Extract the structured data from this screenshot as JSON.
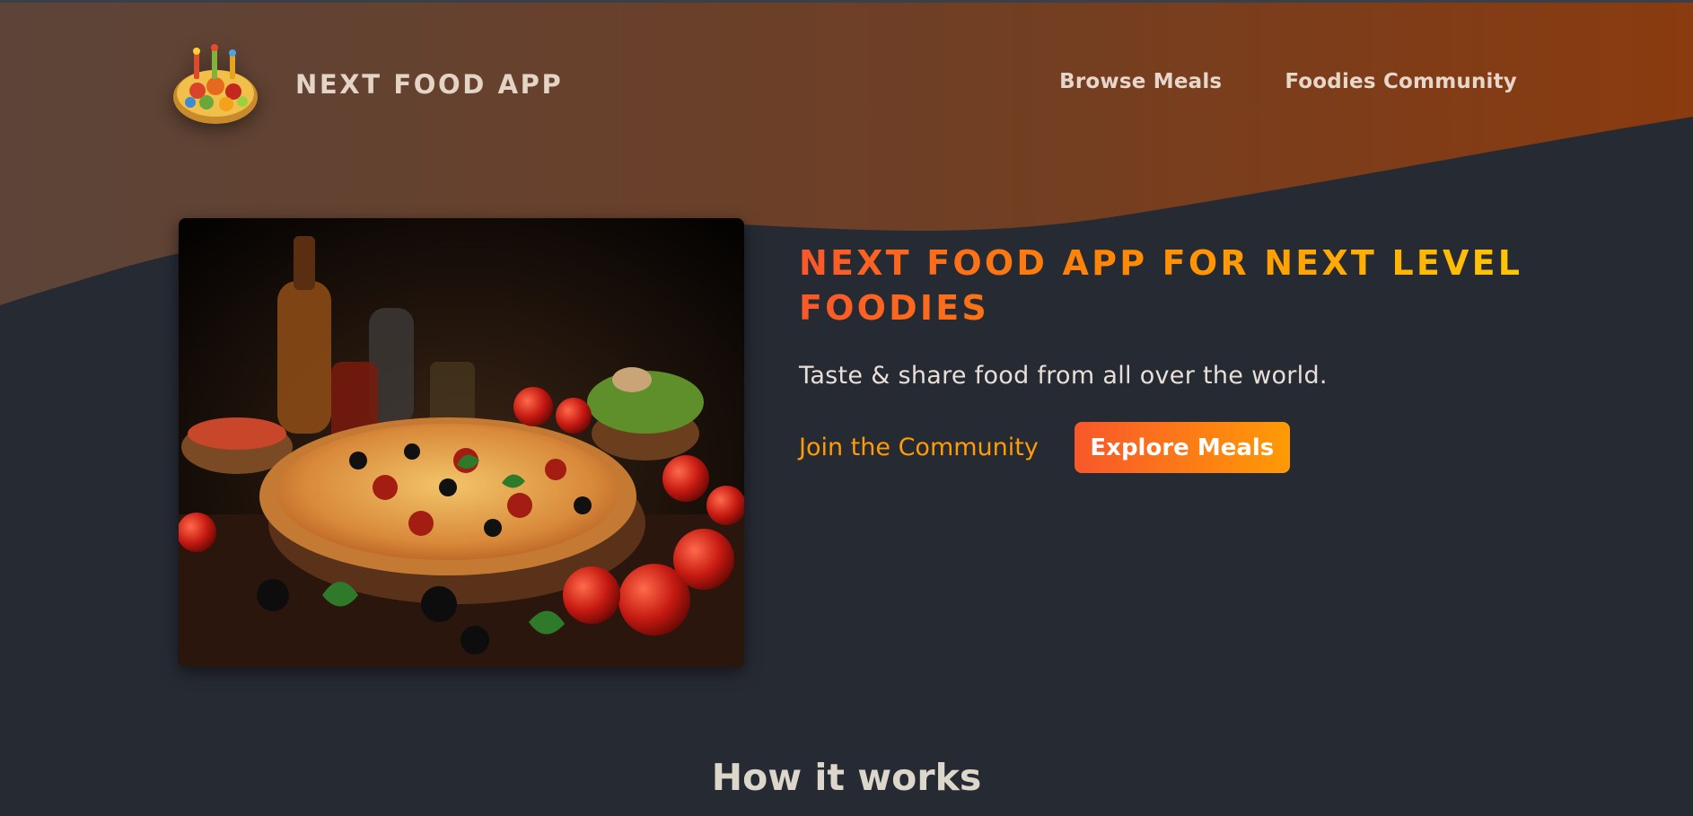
{
  "header": {
    "logo_alt": "A plate with food on it",
    "logo_text": "NEXT FOOD APP",
    "nav": [
      {
        "label": "Browse Meals"
      },
      {
        "label": "Foodies Community"
      }
    ]
  },
  "hero": {
    "image_alt": "A delicious pizza",
    "title": "NEXT FOOD APP FOR NEXT LEVEL FOODIES",
    "subtitle": "Taste & share food from all over the world.",
    "community_link": "Join the Community",
    "explore_button": "Explore Meals"
  },
  "how_it_works": {
    "heading": "How it works"
  },
  "colors": {
    "background": "#262a33",
    "accent_start": "#f9572a",
    "accent_end": "#ff9b05",
    "header_wave_start": "#5c4438",
    "header_wave_end": "#8a3b0f"
  }
}
